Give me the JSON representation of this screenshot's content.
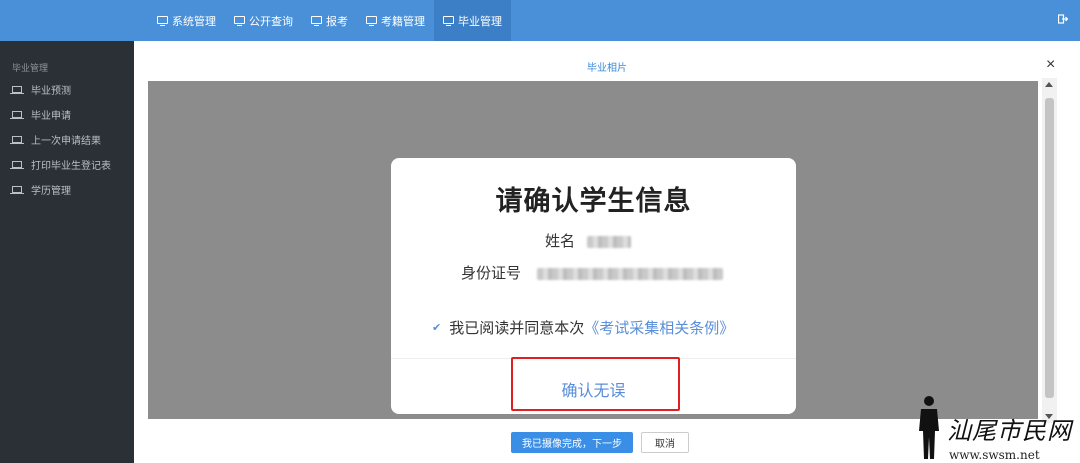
{
  "topnav": {
    "items": [
      {
        "label": "系统管理",
        "active": false
      },
      {
        "label": "公开查询",
        "active": false
      },
      {
        "label": "报考",
        "active": false
      },
      {
        "label": "考籍管理",
        "active": false
      },
      {
        "label": "毕业管理",
        "active": true
      }
    ],
    "exit_icon": "logout-icon",
    "bg_color": "#4a90d9"
  },
  "sidebar": {
    "heading": "毕业管理",
    "items": [
      {
        "label": "毕业预测",
        "icon": "laptop-icon"
      },
      {
        "label": "毕业申请",
        "icon": "laptop-icon"
      },
      {
        "label": "上一次申请结果",
        "icon": "laptop-icon"
      },
      {
        "label": "打印毕业生登记表",
        "icon": "laptop-icon"
      },
      {
        "label": "学历管理",
        "icon": "laptop-icon"
      }
    ]
  },
  "panel": {
    "title": "毕业相片",
    "close": "×"
  },
  "dialog": {
    "title": "请确认学生信息",
    "name_label": "姓名",
    "id_label": "身份证号",
    "agree_text": "我已阅读并同意本次",
    "agree_link": "《考试采集相关条例》",
    "confirm_label": "确认无误",
    "accent_color": "#5a8ed8"
  },
  "footer": {
    "next_label": "我已摄像完成，下一步",
    "cancel_label": "取消"
  },
  "watermark": {
    "text": "汕尾市民网",
    "url": "www.swsm.net"
  }
}
